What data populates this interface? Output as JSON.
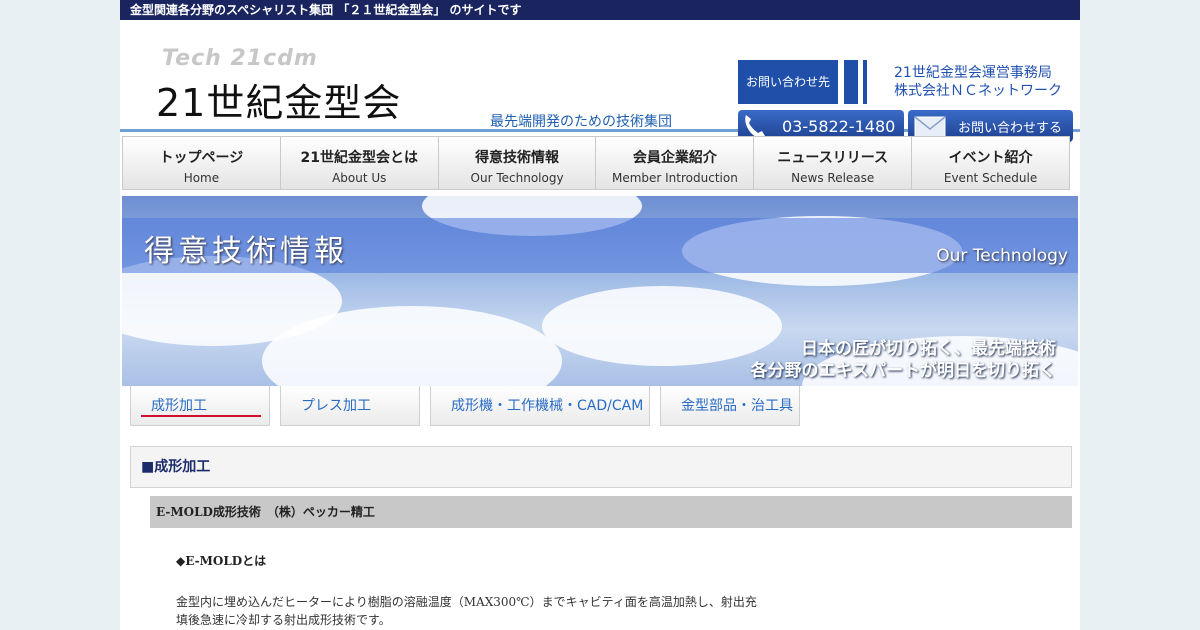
{
  "topbar": {
    "text": "金型関連各分野のスペシャリスト集団 「２１世紀金型会」 のサイトです"
  },
  "header": {
    "logo_tech": "Tech 21cdm",
    "logo_main": "21世紀金型会",
    "tagline": "最先端開発のための技術集団",
    "contact_label": "お問い合わせ先",
    "office_line1": "21世紀金型会運営事務局",
    "office_line2": "株式会社ＮＣネットワーク",
    "tel": "03-5822-1480",
    "mail_button": "お問い合わせする"
  },
  "nav": [
    {
      "jp": "トップページ",
      "en": "Home"
    },
    {
      "jp": "21世紀金型会とは",
      "en": "About Us"
    },
    {
      "jp": "得意技術情報",
      "en": "Our Technology"
    },
    {
      "jp": "会員企業紹介",
      "en": "Member Introduction"
    },
    {
      "jp": "ニュースリリース",
      "en": "News Release"
    },
    {
      "jp": "イベント紹介",
      "en": "Event Schedule"
    }
  ],
  "hero": {
    "title": "得意技術情報",
    "subtitle_en": "Our Technology",
    "line1": "日本の匠が切り拓く、最先端技術",
    "line2": "各分野のエキスパートが明日を切り拓く"
  },
  "tabs": [
    {
      "label": "成形加工"
    },
    {
      "label": "プレス加工"
    },
    {
      "label": "成形機・工作機械・CAD/CAM"
    },
    {
      "label": "金型部品・治工具"
    }
  ],
  "section": {
    "heading": "■成形加工",
    "subheading": "E-MOLD成形技術　（株）ペッカー精工",
    "question": "◆E-MOLDとは",
    "body_line1": "金型内に埋め込んだヒーターにより樹脂の溶融温度（MAX300℃）までキャビティ面を高温加熱し、射出充",
    "body_line2": "填後急速に冷却する射出成形技術です。"
  }
}
